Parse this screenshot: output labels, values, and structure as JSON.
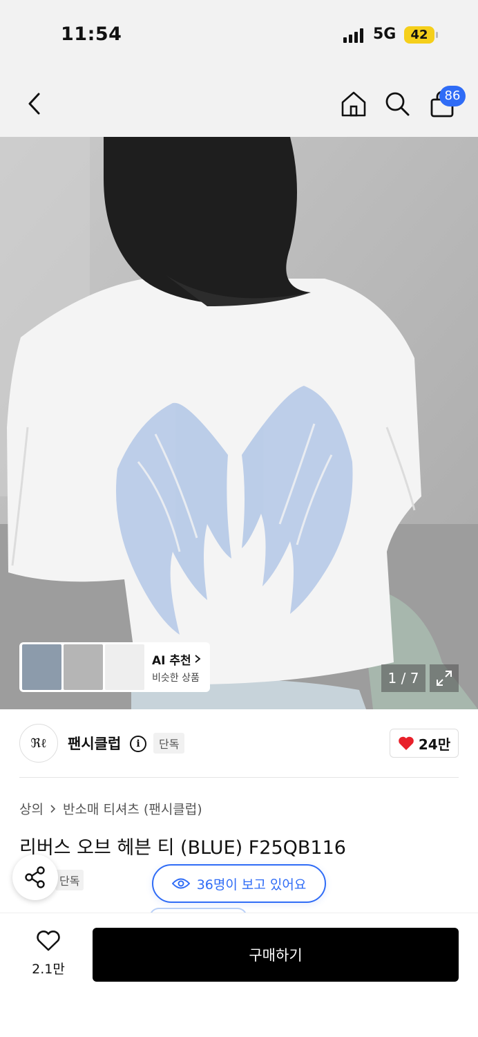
{
  "status_bar": {
    "time": "11:54",
    "network": "5G",
    "battery": "42"
  },
  "nav": {
    "cart_count": "86"
  },
  "gallery": {
    "ai_title": "AI 추천",
    "ai_subtitle": "비슷한 상품",
    "pager": "1 / 7"
  },
  "brand": {
    "logo_text": "ℜℓ",
    "name": "팬시클럽",
    "info_glyph": "i",
    "badge": "단독",
    "likes": "24만"
  },
  "product": {
    "breadcrumb": [
      "상의",
      "반소매 티셔츠 (팬시클럽)"
    ],
    "title": "리버스 오브 헤븐 티 (BLUE) F25QB116",
    "badge": "단독",
    "viewers": "36명이 보고 있어요"
  },
  "bottom": {
    "wish_count": "2.1만",
    "buy_label": "구매하기"
  },
  "colors": {
    "accent": "#2f6cf6",
    "heart": "#e8202a",
    "battery": "#f5cf1b"
  }
}
